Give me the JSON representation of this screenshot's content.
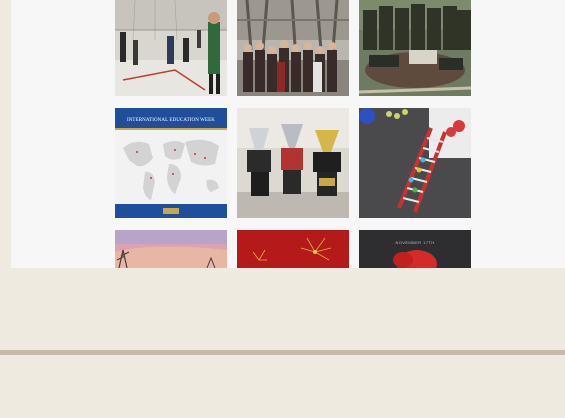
{
  "colors": {
    "page_background": "#efeae0",
    "feed_background": "#f7f7f7",
    "divider": "#c6bba8",
    "map_banner": "#1f4e9c",
    "accent_gold": "#caa64a"
  },
  "feed": {
    "posts": [
      {
        "id": "gym-players",
        "icon": "photo-icon"
      },
      {
        "id": "group-outdoors",
        "icon": "photo-icon"
      },
      {
        "id": "team-group",
        "icon": "photo-icon"
      },
      {
        "id": "map-graphic",
        "icon": "photo-icon",
        "banner_text": "INTERNATIONAL EDUCATION WEEK"
      },
      {
        "id": "trophies",
        "icon": "photo-icon"
      },
      {
        "id": "dna-model",
        "icon": "photo-icon"
      },
      {
        "id": "sunset-trees",
        "icon": "photo-icon"
      },
      {
        "id": "red-celebration",
        "icon": "photo-icon"
      },
      {
        "id": "red-card",
        "icon": "photo-icon",
        "date_text": "NOVEMBER 17TH"
      }
    ]
  }
}
